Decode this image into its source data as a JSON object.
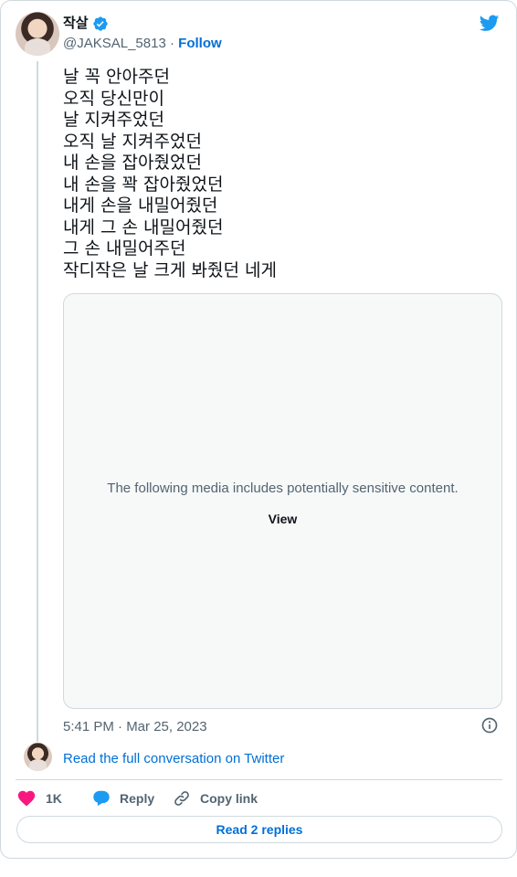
{
  "author": {
    "display_name": "작살",
    "handle": "@JAKSAL_5813",
    "separator": "·",
    "follow_label": "Follow"
  },
  "tweet": {
    "lines": [
      "날 꼭 안아주던",
      "오직 당신만이",
      "날 지켜주었던",
      "오직 날 지켜주었던",
      "내 손을 잡아줬었던",
      "내 손을 꽉 잡아줬었던",
      "내게 손을 내밀어줬던",
      "내게 그 손 내밀어줬던",
      "그 손 내밀어주던",
      "작디작은 날 크게 봐줬던 네게"
    ],
    "media": {
      "sensitive_text": "The following media includes potentially sensitive content.",
      "view_label": "View"
    },
    "timestamp": "5:41 PM · Mar 25, 2023"
  },
  "conversation": {
    "read_full_label": "Read the full conversation on Twitter"
  },
  "actions": {
    "like_count": "1K",
    "reply_label": "Reply",
    "copy_link_label": "Copy link",
    "read_replies_label": "Read 2 replies"
  },
  "icons": {
    "logo": "twitter-bird-icon",
    "verified": "verified-badge-icon",
    "info": "info-icon",
    "like": "heart-icon",
    "reply": "reply-bubble-icon",
    "copy": "link-icon"
  },
  "colors": {
    "brand_blue": "#1d9bf0",
    "link_blue": "#006fd6",
    "like_pink": "#f91880",
    "muted_text": "#536471",
    "border": "#cfd9de"
  }
}
